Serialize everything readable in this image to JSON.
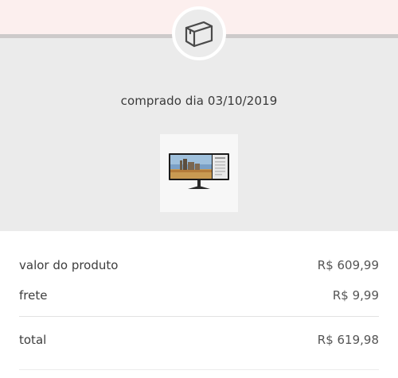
{
  "header": {
    "icon": "box-icon",
    "purchase_date_label": "comprado dia 03/10/2019"
  },
  "product": {
    "image_icon": "monitor-image"
  },
  "summary": {
    "product_value_label": "valor do produto",
    "product_value": "R$ 609,99",
    "shipping_label": "frete",
    "shipping_value": "R$ 9,99",
    "total_label": "total",
    "total_value": "R$ 619,98"
  },
  "colors": {
    "top_band": "#fcefee",
    "panel": "#ebebeb",
    "divider": "#cdcaca"
  }
}
